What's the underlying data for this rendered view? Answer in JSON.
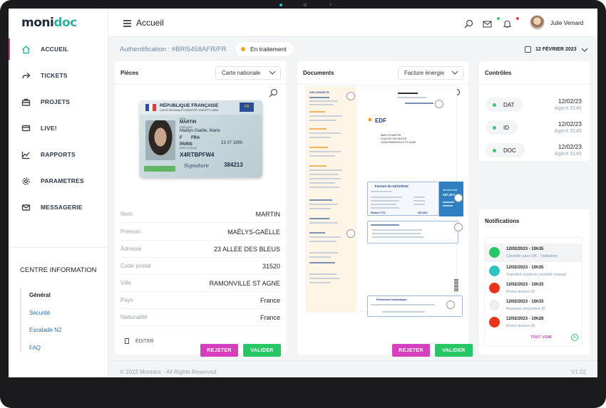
{
  "app": {
    "logo_main": "moni",
    "logo_accent": "doc"
  },
  "header": {
    "title": "Accueil",
    "user_name": "Julie Vemard"
  },
  "sidebar": {
    "items": [
      {
        "label": "ACCUEIL",
        "icon": "home-icon"
      },
      {
        "label": "TICKETS",
        "icon": "share-icon"
      },
      {
        "label": "PROJETS",
        "icon": "briefcase-icon"
      },
      {
        "label": "LIVE!",
        "icon": "monitor-icon"
      },
      {
        "label": "RAPPORTS",
        "icon": "chart-icon"
      },
      {
        "label": "PARAMETRES",
        "icon": "gear-icon"
      },
      {
        "label": "MESSAGERIE",
        "icon": "mail-icon"
      }
    ],
    "centre_title": "CENTRE INFORMATION",
    "centre_items": [
      "Général",
      "Sécurité",
      "Escalade N2",
      "FAQ"
    ]
  },
  "subheader": {
    "auth": "Authentification : #BRI5458AFR/FR",
    "status": "En traitement",
    "status_color": "#f6a623",
    "date": "12 FÉVRIER 2023"
  },
  "pieces": {
    "title": "Pièces",
    "select": "Carte nationale",
    "card": {
      "header": "RÉPUBLIQUE FRANÇAISE",
      "subheader": "CARTE NATIONALE D'IDENTITÉ / IDENTITY CARD",
      "eu": "FR",
      "surname": "MARTIN",
      "given": "Maëlys-Gaëlle, Marie",
      "sex": "F",
      "nationality": "FRA",
      "birth_date": "13 07 1990",
      "birth_place": "PARIS",
      "usage_label": "NOM D'USAGE",
      "doc_no": "X4RTBPFW4",
      "can": "384213",
      "signature": "Signature"
    },
    "rows": [
      {
        "k": "Nom",
        "v": "MARTIN"
      },
      {
        "k": "Prénom",
        "v": "MAËLYS-GAËLLE"
      },
      {
        "k": "Adresse",
        "v": "23 ALLEE DES  BLEUS"
      },
      {
        "k": "Code postal",
        "v": "31520"
      },
      {
        "k": "Ville",
        "v": "RAMONVILLE ST AGNE"
      },
      {
        "k": "Pays",
        "v": "France"
      },
      {
        "k": "Nationalité",
        "v": "France"
      }
    ],
    "edit": "ÉDITER",
    "reject": "REJETER",
    "validate": "VALIDER"
  },
  "documents": {
    "title": "Documents",
    "select": "Facture énergie",
    "invoice": {
      "brand": "EDF",
      "addr1": "MAELYS MARTIN",
      "addr2": "23 ALLEE DES BLEUS",
      "addr3": "31520 RAMONVILLE ST AGNE",
      "facture_title": "Facture du 31/12/2022",
      "montant_label": "Montant total",
      "montant": "267,38 €",
      "total_label": "Facture TTC",
      "total": "267,38 €",
      "prelev_title": "Prélèvement automatique",
      "side_title": "VOS CONTACTS"
    },
    "reject": "REJETER",
    "validate": "VALIDER"
  },
  "controles": {
    "title": "Contrôles",
    "items": [
      {
        "label": "DAT",
        "date": "12/02/23",
        "agent": "Agent 3145"
      },
      {
        "label": "ID",
        "date": "12/02/23",
        "agent": "Agent 3145"
      },
      {
        "label": "DOC",
        "date": "12/02/23",
        "agent": "Agent 3145"
      }
    ],
    "dot_color": "#39c96b"
  },
  "notifications": {
    "title": "Notifications",
    "items": [
      {
        "time": "12/02/2023 - 10h35",
        "text": "Contrôle pass OK - Validation",
        "color": "#27c768"
      },
      {
        "time": "12/02/2023 - 10h35",
        "text": "Transfert système contrôle manuel",
        "color": "#2ec4c4"
      },
      {
        "time": "12/02/2023 - 10h33",
        "text": "Erreur lecture ID",
        "color": "#e8341c"
      },
      {
        "time": "12/02/2023 - 10h33",
        "text": "Nouveau document ID",
        "color": "#eeeeee"
      },
      {
        "time": "12/02/2023 - 10h28",
        "text": "Erreur lecture ID",
        "color": "#e8341c"
      }
    ],
    "see_all": "TOUT VOIR"
  },
  "footer": {
    "copyright": "© 2022 Monidoc - All Rights Reserved.",
    "version": "V1.02"
  }
}
